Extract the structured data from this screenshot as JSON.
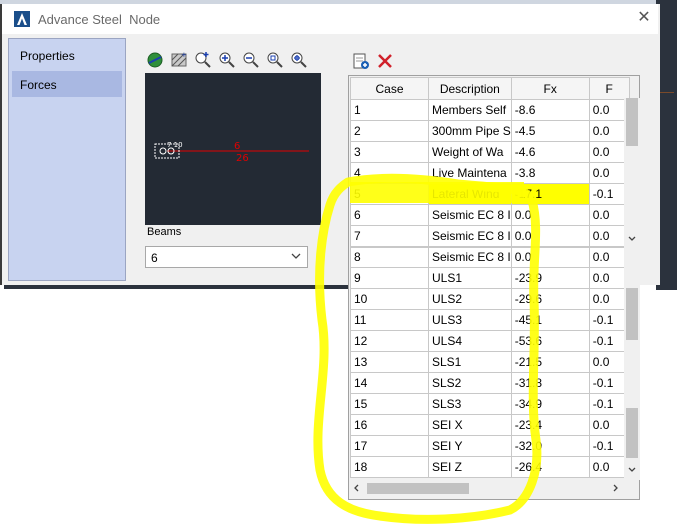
{
  "window": {
    "app_name": "Advance Steel",
    "title": "Node",
    "close_glyph": "✕"
  },
  "left_panel": {
    "items": [
      {
        "label": "Properties"
      },
      {
        "label": "Forces"
      }
    ],
    "selected_index": 1
  },
  "preview": {
    "toolbar_icons": [
      "globe-icon",
      "hatch-icon",
      "zoom-plus-icon",
      "zoom-in-icon",
      "zoom-out-icon",
      "zoom-window-icon",
      "zoom-extents-icon"
    ],
    "beam_label_top": "6",
    "beam_label_bottom": "26",
    "node_labels": "7 10"
  },
  "beams": {
    "label": "Beams",
    "selected_value": "6"
  },
  "grid_toolbar": {
    "icons": [
      "export-icon",
      "delete-icon"
    ]
  },
  "grid": {
    "columns": [
      "Case",
      "Description",
      "Fx",
      "F"
    ],
    "rows": [
      {
        "case": "1",
        "description": "Members Self",
        "fx": "-8.6",
        "f": "0.0"
      },
      {
        "case": "2",
        "description": "300mm Pipe S",
        "fx": "-4.5",
        "f": "0.0"
      },
      {
        "case": "3",
        "description": "Weight of Wa",
        "fx": "-4.6",
        "f": "0.0"
      },
      {
        "case": "4",
        "description": "Live Maintena",
        "fx": "-3.8",
        "f": "0.0"
      },
      {
        "case": "5",
        "description": "Lateral Wind",
        "fx": "-17.1",
        "f": "-0.1"
      },
      {
        "case": "6",
        "description": "Seismic EC 8 I",
        "fx": "0.0",
        "f": "0.0"
      },
      {
        "case": "7",
        "description": "Seismic EC 8 I",
        "fx": "0.0",
        "f": "0.0"
      },
      {
        "case": "8",
        "description": "Seismic EC 8 I",
        "fx": "0.0",
        "f": "0.0"
      },
      {
        "case": "9",
        "description": "ULS1",
        "fx": "-23.9",
        "f": "0.0"
      },
      {
        "case": "10",
        "description": "ULS2",
        "fx": "-29.6",
        "f": "0.0"
      },
      {
        "case": "11",
        "description": "ULS3",
        "fx": "-45.1",
        "f": "-0.1"
      },
      {
        "case": "12",
        "description": "ULS4",
        "fx": "-53.6",
        "f": "-0.1"
      },
      {
        "case": "13",
        "description": "SLS1",
        "fx": "-21.5",
        "f": "0.0"
      },
      {
        "case": "14",
        "description": "SLS2",
        "fx": "-31.8",
        "f": "-0.1"
      },
      {
        "case": "15",
        "description": "SLS3",
        "fx": "-34.9",
        "f": "-0.1"
      },
      {
        "case": "16",
        "description": "SEI X",
        "fx": "-23.4",
        "f": "0.0"
      },
      {
        "case": "17",
        "description": "SEI Y",
        "fx": "-32.0",
        "f": "-0.1"
      },
      {
        "case": "18",
        "description": "SEI Z",
        "fx": "-26.4",
        "f": "0.0"
      }
    ]
  },
  "colors": {
    "highlight": "#ffff00",
    "beam_line": "#e00000",
    "preview_bg": "#232a34",
    "selection_panel": "#c8d3f0"
  }
}
